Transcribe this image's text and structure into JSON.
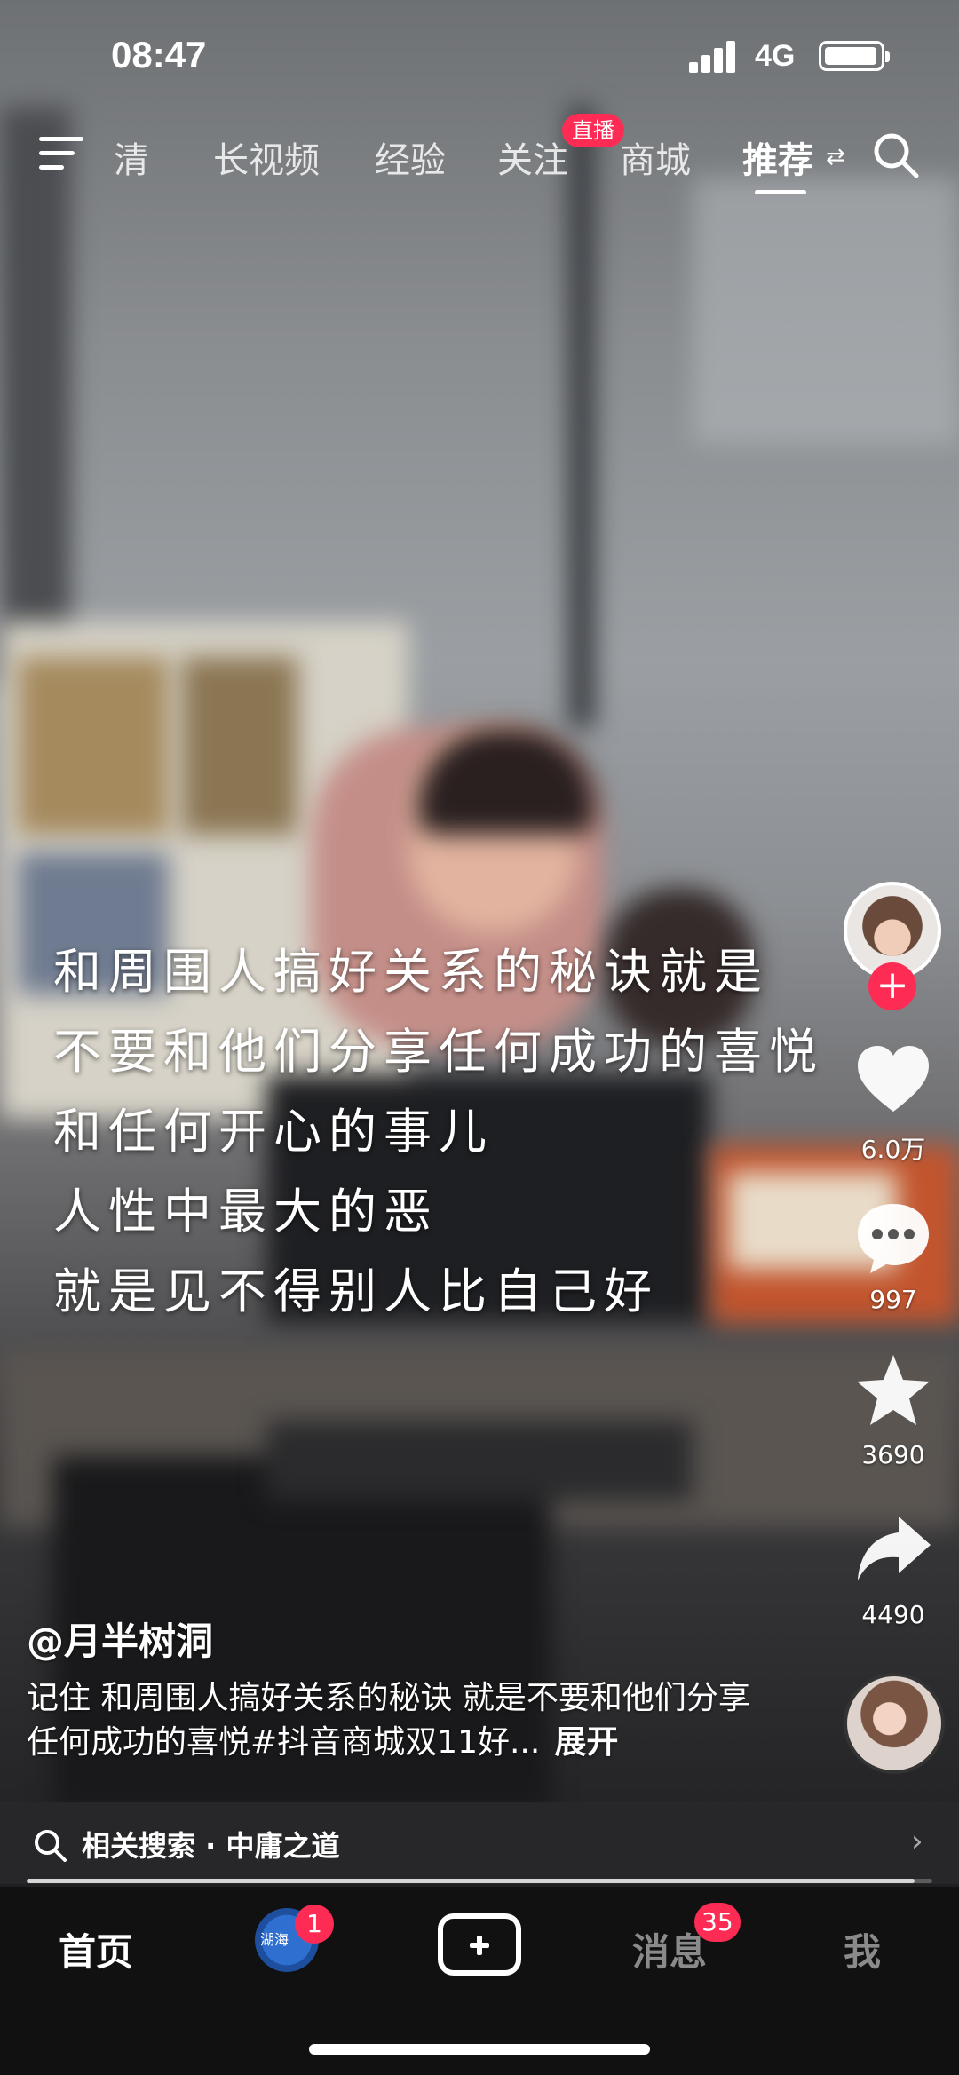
{
  "status_bar": {
    "time": "08:47",
    "network": "4G"
  },
  "top_nav": {
    "tabs": [
      {
        "label": "高清",
        "display": "清"
      },
      {
        "label": "长视频"
      },
      {
        "label": "经验"
      },
      {
        "label": "关注"
      },
      {
        "label": "商城"
      },
      {
        "label": "推荐"
      }
    ],
    "active_tab": "推荐",
    "live_badge": "直播",
    "icons": [
      "menu-icon",
      "swap-icon",
      "search-icon"
    ]
  },
  "overlay_text": [
    "和周围人搞好关系的秘诀就是",
    "不要和他们分享任何成功的喜悦",
    "和任何开心的事儿",
    "人性中最大的恶",
    "就是见不得别人比自己好"
  ],
  "right_rail": {
    "follow_icon": "plus-icon",
    "likes": "6.0万",
    "comments": "997",
    "favorites": "3690",
    "shares": "4490"
  },
  "caption": {
    "author": "@月半树洞",
    "description": "记住 和周围人搞好关系的秘诀 就是不要和他们分享任何成功的喜悦#抖音商城双11好...",
    "expand_label": "展开"
  },
  "related_search": {
    "label": "相关搜索 · 中庸之道",
    "icon": "search-icon",
    "chevron": "›"
  },
  "playback": {
    "progress": 0.98
  },
  "tab_bar": {
    "home": "首页",
    "friends_badge": "1",
    "friends_avatar_text": "湖海",
    "messages": "消息",
    "messages_badge": "35",
    "me": "我"
  },
  "colors": {
    "accent": "#fe2c55",
    "tabbar_bg": "#111111"
  }
}
